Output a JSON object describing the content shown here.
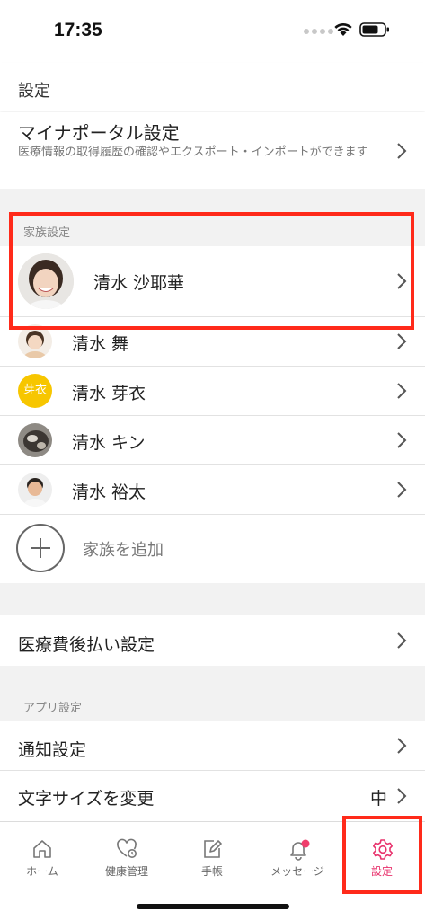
{
  "status_bar": {
    "time": "17:35"
  },
  "nav": {
    "title": "設定"
  },
  "myna": {
    "title": "マイナポータル設定",
    "description": "医療情報の取得履歴の確認やエクスポート・インポートができます"
  },
  "family": {
    "section_label": "家族設定",
    "members": [
      {
        "name": "清水 沙耶華"
      },
      {
        "name": "清水 舞"
      },
      {
        "name": "清水 芽衣",
        "avatar_text": "芽衣"
      },
      {
        "name": "清水 キン"
      },
      {
        "name": "清水 裕太"
      }
    ],
    "add_label": "家族を追加"
  },
  "payment": {
    "label": "医療費後払い設定"
  },
  "app_settings": {
    "section_label": "アプリ設定",
    "notification_label": "通知設定",
    "font_size_label": "文字サイズを変更",
    "font_size_value": "中"
  },
  "tabs": [
    {
      "label": "ホーム",
      "icon": "home-icon"
    },
    {
      "label": "健康管理",
      "icon": "health-icon"
    },
    {
      "label": "手帳",
      "icon": "notebook-edit-icon"
    },
    {
      "label": "メッセージ",
      "icon": "bell-icon"
    },
    {
      "label": "設定",
      "icon": "gear-icon"
    }
  ],
  "colors": {
    "accent": "#e8336d",
    "highlight": "#ff2a1a",
    "meii_avatar": "#f7c600",
    "notification_badge": "#ef3d6b"
  }
}
